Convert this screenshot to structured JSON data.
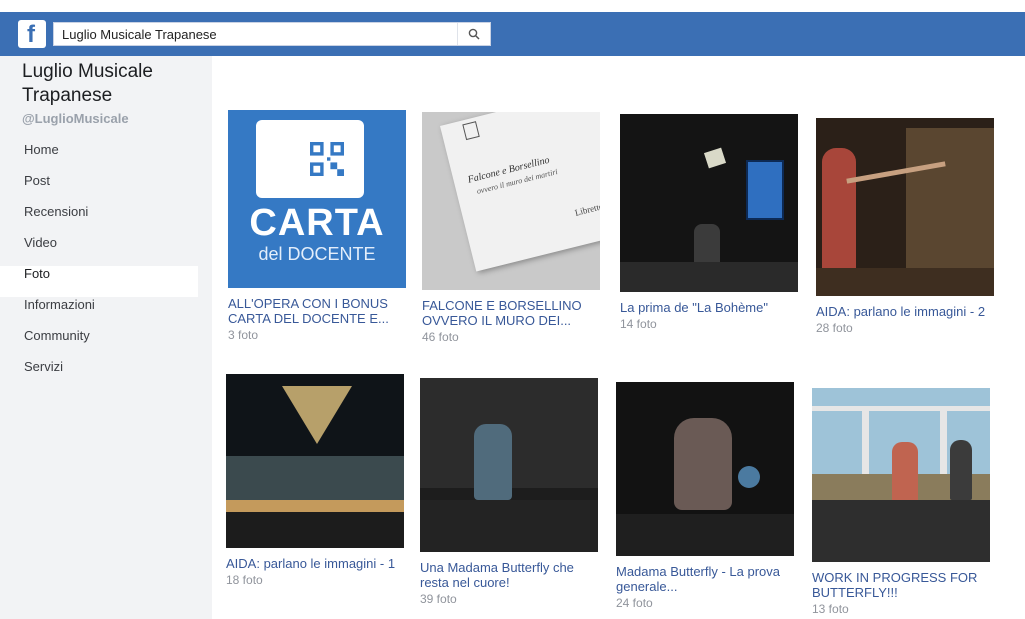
{
  "header": {
    "logo_letter": "f",
    "search_value": "Luglio Musicale Trapanese",
    "brand_color": "#3b6fb4"
  },
  "sidebar": {
    "page_name": "Luglio Musicale Trapanese",
    "handle": "@LuglioMusicale",
    "items": [
      {
        "label": "Home"
      },
      {
        "label": "Post"
      },
      {
        "label": "Recensioni"
      },
      {
        "label": "Video"
      },
      {
        "label": "Foto",
        "active": true
      },
      {
        "label": "Informazioni"
      },
      {
        "label": "Community"
      },
      {
        "label": "Servizi"
      }
    ]
  },
  "albums": [
    {
      "title": "ALL'OPERA CON I BONUS CARTA DEL DOCENTE E...",
      "count": "3 foto",
      "thumb": {
        "word": "CARTA",
        "sub": "del DOCENTE"
      }
    },
    {
      "title": "FALCONE E BORSELLINO OVVERO IL MURO DEI...",
      "count": "46 foto",
      "thumb": {
        "doc_title": "Falcone e Borsellino",
        "doc_sub": "ovvero il muro dei martiri",
        "doc_corner": "Libretto"
      }
    },
    {
      "title": "La prima de \"La Bohème\"",
      "count": "14 foto"
    },
    {
      "title": "AIDA: parlano le immagini - 2",
      "count": "28 foto"
    },
    {
      "title": "AIDA: parlano le immagini - 1",
      "count": "18 foto"
    },
    {
      "title": "Una Madama Butterfly che resta nel cuore!",
      "count": "39 foto"
    },
    {
      "title": "Madama Butterfly - La prova generale...",
      "count": "24 foto"
    },
    {
      "title": "WORK IN PROGRESS FOR BUTTERFLY!!!",
      "count": "13 foto"
    }
  ]
}
